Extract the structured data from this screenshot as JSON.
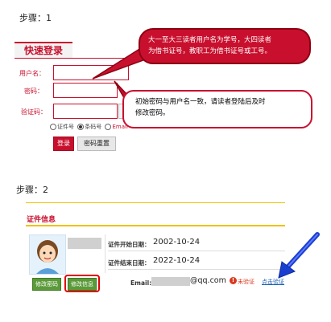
{
  "step1": {
    "label": "步骤：1"
  },
  "login": {
    "title": "快速登录",
    "username_label": "用户名：",
    "password_label": "密码：",
    "captcha_label": "验证码：",
    "radio_options": [
      "证件号",
      "条码号",
      "Email"
    ],
    "selected_radio": "条码号",
    "login_button": "登录",
    "reset_button": "密码重置"
  },
  "note1": {
    "line1": "大一至大三读者用户名为学号，大四读者",
    "line2": "为借书证号，教职工为借书证号或工号。"
  },
  "note2": {
    "line1": "初始密码与用户名一致，请读者登陆后及时",
    "line2": "修改密码。"
  },
  "step2": {
    "label": "步骤：2"
  },
  "cert": {
    "section_title": "证件信息",
    "start_label": "证件开始日期：",
    "start_value": "2002-10-24",
    "end_label": "证件结束日期：",
    "end_value": "2022-10-24",
    "email_label": "Email:",
    "email_value": "@qq.com",
    "unverified_text": "未验证",
    "verify_link": "点击验证",
    "btn_change_password": "修改密码",
    "btn_change_info": "修改信息"
  },
  "colors": {
    "accent_red": "#c8102e",
    "arrow_blue": "#1a3fd0",
    "button_green": "#5b9a3a",
    "rule_yellow": "#f0c000"
  },
  "icons": [
    "avatar-icon",
    "error-icon",
    "blue-arrow-icon"
  ]
}
